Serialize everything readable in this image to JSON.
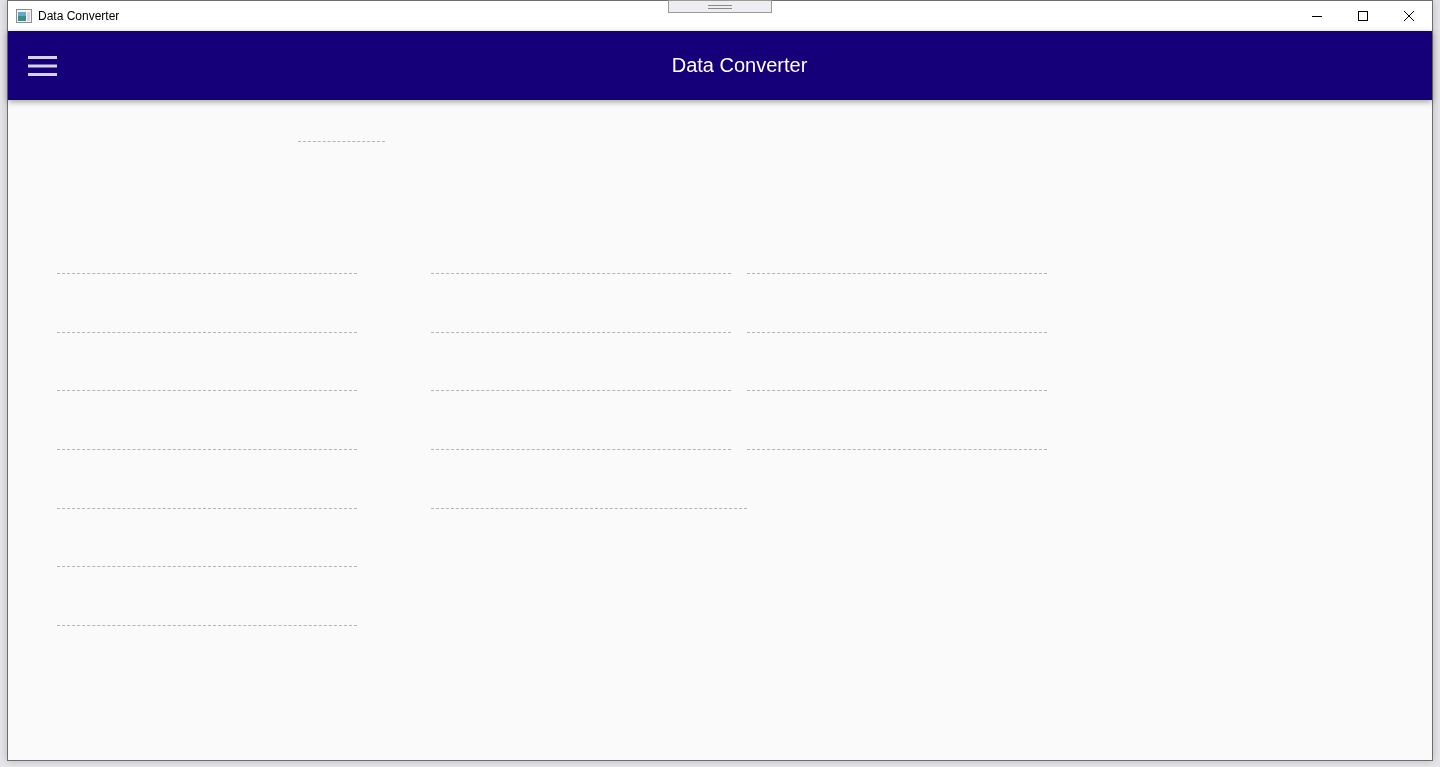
{
  "window": {
    "title": "Data Converter"
  },
  "app_bar": {
    "title": "Data Converter"
  },
  "top_field": {
    "disabled": true
  },
  "columns": [
    {
      "fields": [
        {
          "kind": "field",
          "disabled": true
        },
        {
          "kind": "field",
          "disabled": true
        },
        {
          "kind": "field",
          "disabled": true
        },
        {
          "kind": "field",
          "disabled": true
        },
        {
          "kind": "field",
          "disabled": true
        },
        {
          "kind": "field",
          "disabled": true
        },
        {
          "kind": "field",
          "disabled": true
        }
      ]
    },
    {
      "fields": [
        {
          "kind": "field",
          "disabled": true
        },
        {
          "kind": "field",
          "disabled": true
        },
        {
          "kind": "field",
          "disabled": true
        },
        {
          "kind": "field",
          "disabled": true
        },
        {
          "kind": "wide_field",
          "disabled": true
        }
      ]
    },
    {
      "fields": [
        {
          "kind": "field",
          "disabled": true
        },
        {
          "kind": "field",
          "disabled": true
        },
        {
          "kind": "field",
          "disabled": true
        },
        {
          "kind": "field",
          "disabled": true
        }
      ]
    }
  ]
}
